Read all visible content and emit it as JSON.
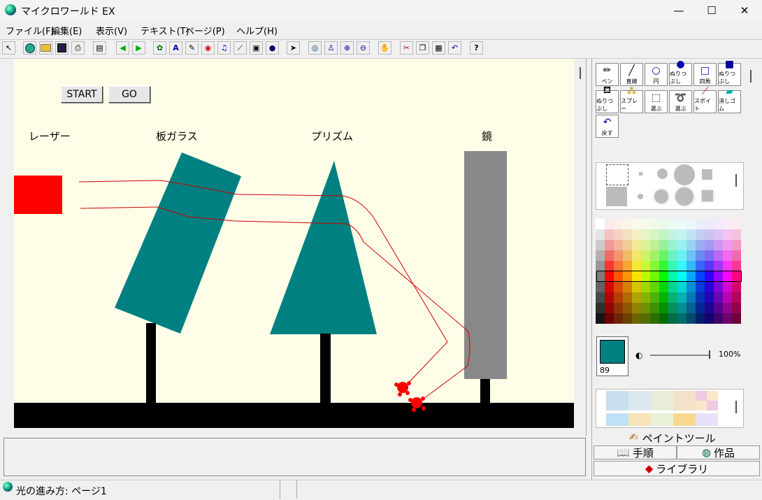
{
  "window": {
    "title": "マイクロワールド EX",
    "minimize": "—",
    "maximize": "☐",
    "close": "✕"
  },
  "menu": [
    "ファイル(F)",
    "編集(E)",
    "表示(V)",
    "テキスト(T)",
    "ページ(P)",
    "ヘルプ(H)"
  ],
  "toolbar_icons": [
    "cursor-icon",
    "globe-icon",
    "open-folder-icon",
    "save-icon",
    "print-icon",
    "book-icon",
    "arrow-left-icon",
    "arrow-right-icon",
    "turtle-icon",
    "textbox-icon",
    "pen-icon",
    "eye-icon",
    "music-icon",
    "wand-icon",
    "video-icon",
    "record-icon",
    "pointer-icon",
    "eye-icon",
    "stamp-icon",
    "zoom-in-icon",
    "zoom-out-icon",
    "hand-stop-icon",
    "scissors-icon",
    "copy-icon",
    "paste-icon",
    "undo-icon",
    "help-icon"
  ],
  "canvas": {
    "buttons": {
      "start": "START",
      "go": "GO"
    },
    "labels": {
      "laser": "レーザー",
      "glass": "板ガラス",
      "prism": "プリズム",
      "mirror": "鏡"
    },
    "colors": {
      "background": "#fefee8",
      "laser": "#ff0000",
      "teal": "#008080",
      "mirror": "#888888",
      "ground": "#000000"
    }
  },
  "paint_tools": {
    "row1": [
      "ペン",
      "直線",
      "円",
      "ぬりつぶし",
      "四角",
      "ぬりつぶし"
    ],
    "row2": [
      "ぬりつぶし",
      "スプレー",
      "選ぶ",
      "選ぶ",
      "スポイト",
      "消しゴム"
    ],
    "row3": [
      "戻す"
    ]
  },
  "color_panel": {
    "selected_index": "89",
    "selected_color": "#008080",
    "opacity": "100%"
  },
  "tabs": {
    "paint": "ペイントツール",
    "procedures": "手順",
    "works": "作品",
    "library": "ライブラリ"
  },
  "status": {
    "page": "光の進み方: ページ1"
  }
}
